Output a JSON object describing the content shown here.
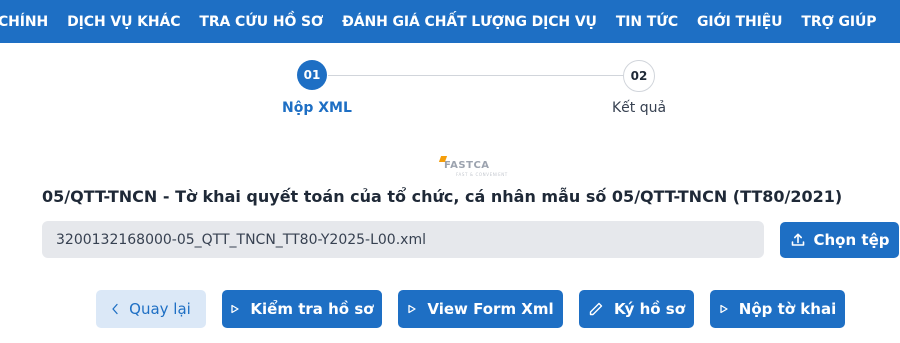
{
  "nav": {
    "items": [
      "CHÍNH",
      "DỊCH VỤ KHÁC",
      "TRA CỨU HỒ SƠ",
      "ĐÁNH GIÁ CHẤT LƯỢNG DỊCH VỤ",
      "TIN TỨC",
      "GIỚI THIỆU",
      "TRỢ GIÚP"
    ]
  },
  "stepper": {
    "steps": [
      {
        "number": "01",
        "label": "Nộp XML",
        "active": true
      },
      {
        "number": "02",
        "label": "Kết quả",
        "active": false
      }
    ]
  },
  "watermark": {
    "text": "FASTCA",
    "subtext": "FAST & CONVENIENT"
  },
  "form": {
    "title": "05/QTT-TNCN - Tờ khai quyết toán của tổ chức, cá nhân mẫu số 05/QTT-TNCN (TT80/2021)",
    "file_value": "3200132168000-05_QTT_TNCN_TT80-Y2025-L00.xml",
    "choose_file_label": "Chọn tệp"
  },
  "actions": {
    "back_label": "Quay lại",
    "check_label": "Kiểm tra hồ sơ",
    "view_xml_label": "View Form Xml",
    "sign_label": "Ký hồ sơ",
    "submit_label": "Nộp tờ khai"
  },
  "colors": {
    "primary": "#1e6fc4",
    "secondary_bg": "#dbe8f7",
    "input_bg": "#e6e8ec"
  }
}
